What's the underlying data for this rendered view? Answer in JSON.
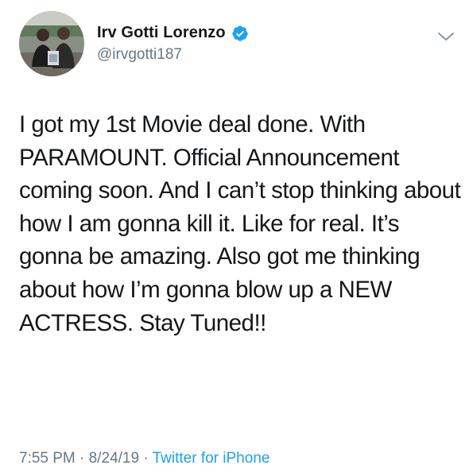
{
  "tweet": {
    "display_name": "Irv Gotti Lorenzo",
    "handle": "@irvgotti187",
    "verified": true,
    "icons": {
      "verified": "verified-badge-icon",
      "menu": "chevron-down-icon"
    },
    "text": "I got my 1st Movie deal done. With PARAMOUNT. Official Announcement coming soon. And I can’t stop thinking about how I am gonna kill it. Like for real. It’s gonna be amazing. Also got me thinking about how I’m gonna blow up a NEW ACTRESS. Stay Tuned!!",
    "time": "7:55 PM",
    "separator": "·",
    "date": "8/24/19",
    "source": "Twitter for iPhone"
  },
  "colors": {
    "text": "#14171a",
    "secondary": "#657786",
    "link": "#1da1f2",
    "verified": "#1da1f2"
  }
}
